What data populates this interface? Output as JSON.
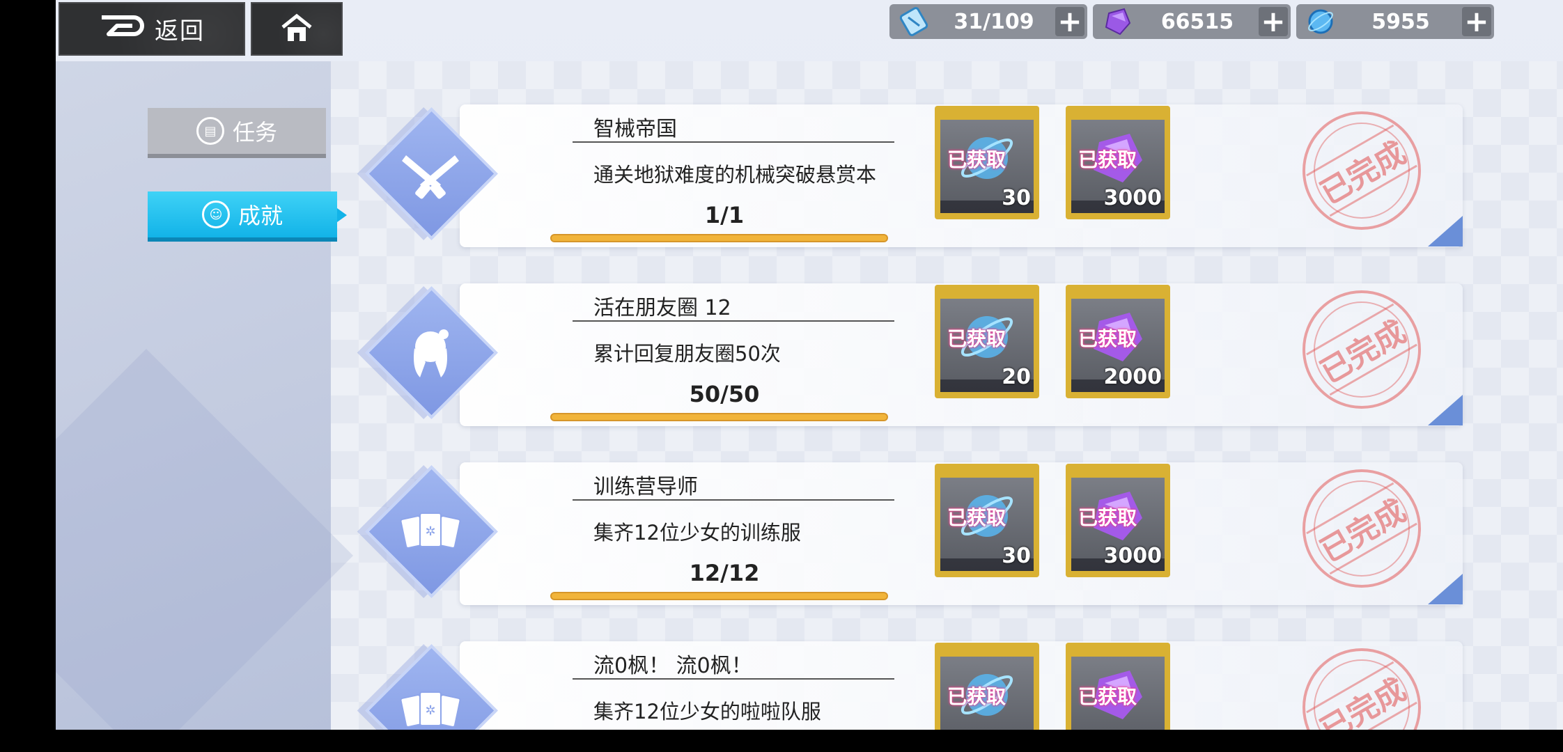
{
  "topbar": {
    "back_label": "返回",
    "resources": [
      {
        "icon": "stamina-hourglass-icon",
        "value": "31/109"
      },
      {
        "icon": "purple-crystal-icon",
        "value": "66515"
      },
      {
        "icon": "blue-orb-icon",
        "value": "5955"
      }
    ],
    "plus": "+"
  },
  "tabs": {
    "task": "任务",
    "achievement": "成就"
  },
  "achievements": [
    {
      "icon": "crossed-revolvers-icon",
      "title": "智械帝国",
      "desc": "通关地狱难度的机械突破悬赏本",
      "progress": "1/1",
      "rewards": [
        {
          "icon": "blue-orb-icon",
          "status": "已获取",
          "amount": "30"
        },
        {
          "icon": "purple-crystal-icon",
          "status": "已获取",
          "amount": "3000"
        }
      ],
      "stamp": "已完成"
    },
    {
      "icon": "girl-silhouette-icon",
      "title": "活在朋友圈 12",
      "desc": "累计回复朋友圈50次",
      "progress": "50/50",
      "rewards": [
        {
          "icon": "blue-orb-icon",
          "status": "已获取",
          "amount": "20"
        },
        {
          "icon": "purple-crystal-icon",
          "status": "已获取",
          "amount": "2000"
        }
      ],
      "stamp": "已完成"
    },
    {
      "icon": "cards-icon",
      "title": "训练营导师",
      "desc": "集齐12位少女的训练服",
      "progress": "12/12",
      "rewards": [
        {
          "icon": "blue-orb-icon",
          "status": "已获取",
          "amount": "30"
        },
        {
          "icon": "purple-crystal-icon",
          "status": "已获取",
          "amount": "3000"
        }
      ],
      "stamp": "已完成"
    },
    {
      "icon": "cards-icon",
      "title": "流0枫！ 流0枫！",
      "desc": "集齐12位少女的啦啦队服",
      "rewards": [
        {
          "icon": "blue-orb-icon",
          "status": "已获取"
        },
        {
          "icon": "purple-crystal-icon",
          "status": "已获取"
        }
      ],
      "stamp": "已完成"
    }
  ]
}
